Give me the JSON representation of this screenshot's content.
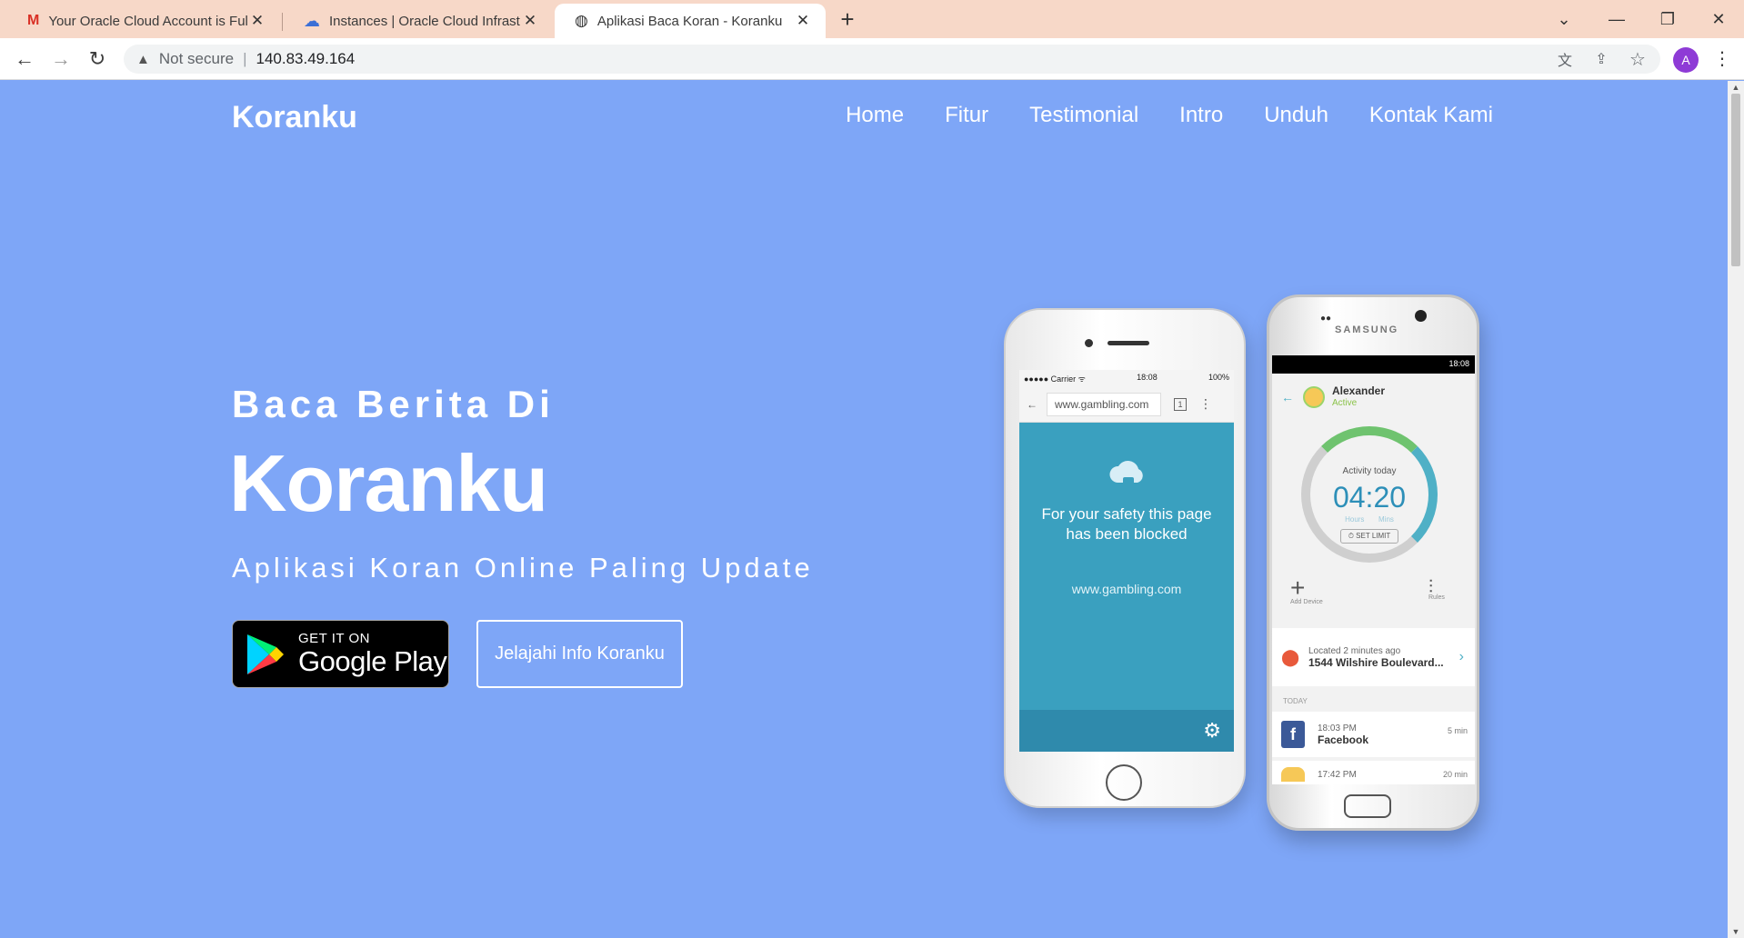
{
  "browser": {
    "tabs": [
      {
        "title": "Your Oracle Cloud Account is Full",
        "icon": "gmail-icon"
      },
      {
        "title": "Instances | Oracle Cloud Infrastructure",
        "icon": "cloud-icon"
      },
      {
        "title": "Aplikasi Baca Koran - Koranku",
        "icon": "globe-icon",
        "active": true
      }
    ],
    "security_label": "Not secure",
    "url": "140.83.49.164",
    "avatar_letter": "A"
  },
  "site": {
    "brand": "Koranku",
    "nav": [
      "Home",
      "Fitur",
      "Testimonial",
      "Intro",
      "Unduh",
      "Kontak Kami"
    ]
  },
  "hero": {
    "pre_title": "Baca Berita Di",
    "title": "Koranku",
    "subtitle": "Aplikasi Koran Online Paling Update",
    "google_play": {
      "small": "GET IT ON",
      "big": "Google Play"
    },
    "explore_button": "Jelajahi Info Koranku"
  },
  "phone_left": {
    "status_carrier": "●●●●● Carrier ᯤ",
    "status_time": "18:08",
    "status_battery": "100%",
    "address": "www.gambling.com",
    "tab_count": "1",
    "message": "For your safety this page has been blocked",
    "blocked_url": "www.gambling.com"
  },
  "phone_right": {
    "brand": "SAMSUNG",
    "status_time": "18:08",
    "user_name": "Alexander",
    "user_status": "Active",
    "activity_label": "Activity today",
    "activity_time": "04:20",
    "hours_label": "Hours",
    "mins_label": "Mins",
    "set_limit": "⏱ SET LIMIT",
    "add_device": "Add Device",
    "rules": "Rules",
    "location_time": "Located 2 minutes ago",
    "location_addr": "1544 Wilshire Boulevard...",
    "today_label": "TODAY",
    "fb_time": "18:03 PM",
    "fb_name": "Facebook",
    "fb_duration": "5 min",
    "next_time": "17:42 PM",
    "next_duration": "20 min"
  },
  "colors": {
    "page_bg": "#7ea6f7",
    "tabbar_bg": "#f7d8c8",
    "screen_teal": "#3aa0bf"
  }
}
